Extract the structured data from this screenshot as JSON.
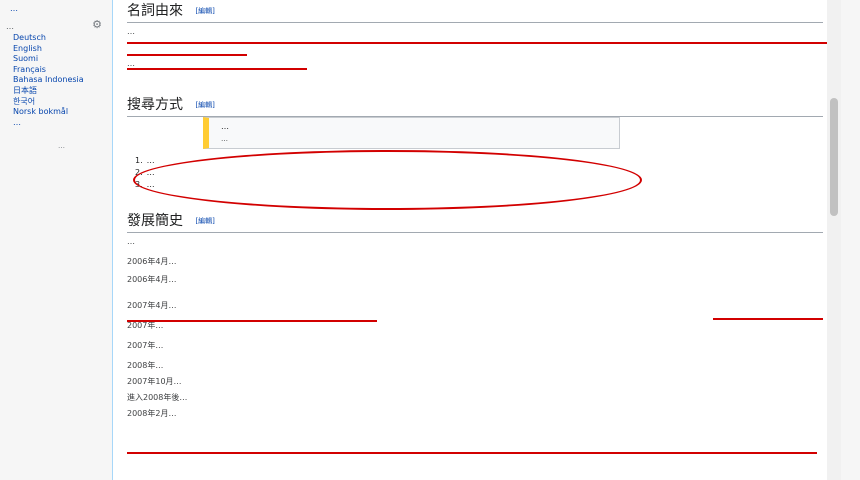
{
  "sidebar": {
    "top_link": "…",
    "languages_heading": "…",
    "languages": [
      "Deutsch",
      "English",
      "Suomi",
      "Français",
      "Bahasa Indonesia",
      "日本語",
      "한국어",
      "Norsk bokmål",
      "…"
    ],
    "edit_links": "…"
  },
  "sections": {
    "naming": {
      "title": "名詞由來",
      "edit": "[編輯]",
      "paragraph_1": "…",
      "paragraph_2": "…"
    },
    "search": {
      "title": "搜尋方式",
      "edit": "[編輯]",
      "notice_title": "…",
      "notice_body": "…",
      "items": [
        "…",
        "…",
        "…"
      ]
    },
    "history": {
      "title": "發展簡史",
      "edit": "[編輯]",
      "paragraphs": [
        "…",
        "2006年4月…",
        "2006年4月…",
        "2007年4月…",
        "2007年…",
        "2007年…",
        "2008年…",
        "2007年10月…",
        "進入2008年後…",
        "2008年2月…"
      ]
    }
  },
  "colors": {
    "link": "#0645ad",
    "annotation": "#d20000",
    "notice_accent": "#ffcc33"
  }
}
